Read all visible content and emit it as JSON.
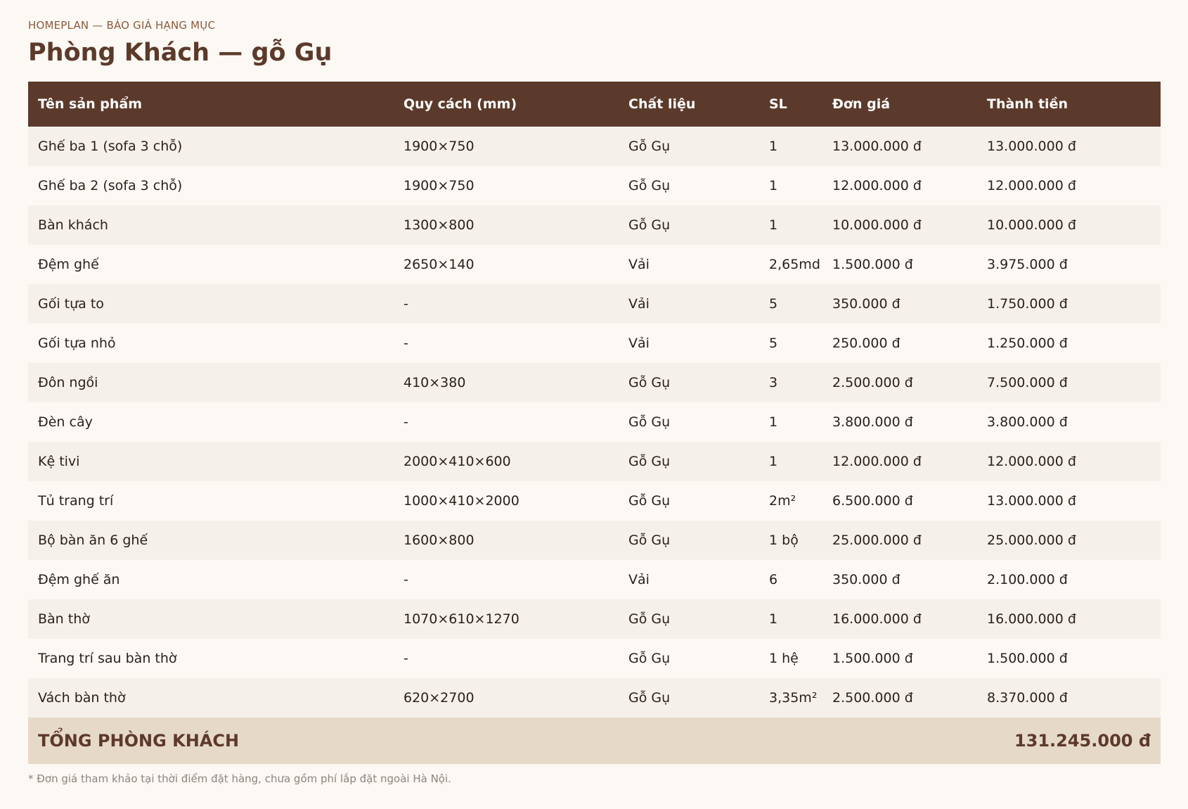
{
  "header": {
    "kicker": "HOMEPLAN — BÁO GIÁ HẠNG MỤC",
    "title": "Phòng Khách — gỗ Gụ"
  },
  "table": {
    "columns": [
      "Tên sản phẩm",
      "Quy cách (mm)",
      "Chất liệu",
      "SL",
      "Đơn giá",
      "Thành tiền"
    ],
    "rows": [
      [
        "Ghế ba 1 (sofa 3 chỗ)",
        "1900×750",
        "Gỗ Gụ",
        "1",
        "13.000.000 đ",
        "13.000.000 đ"
      ],
      [
        "Ghế ba 2 (sofa 3 chỗ)",
        "1900×750",
        "Gỗ Gụ",
        "1",
        "12.000.000 đ",
        "12.000.000 đ"
      ],
      [
        "Bàn khách",
        "1300×800",
        "Gỗ Gụ",
        "1",
        "10.000.000 đ",
        "10.000.000 đ"
      ],
      [
        "Đệm ghế",
        "2650×140",
        "Vải",
        "2,65md",
        "1.500.000 đ",
        "3.975.000 đ"
      ],
      [
        "Gối tựa to",
        "-",
        "Vải",
        "5",
        "350.000 đ",
        "1.750.000 đ"
      ],
      [
        "Gối tựa nhỏ",
        "-",
        "Vải",
        "5",
        "250.000 đ",
        "1.250.000 đ"
      ],
      [
        "Đôn ngồi",
        "410×380",
        "Gỗ Gụ",
        "3",
        "2.500.000 đ",
        "7.500.000 đ"
      ],
      [
        "Đèn cây",
        "-",
        "Gỗ Gụ",
        "1",
        "3.800.000 đ",
        "3.800.000 đ"
      ],
      [
        "Kệ tivi",
        "2000×410×600",
        "Gỗ Gụ",
        "1",
        "12.000.000 đ",
        "12.000.000 đ"
      ],
      [
        "Tủ trang trí",
        "1000×410×2000",
        "Gỗ Gụ",
        "2m²",
        "6.500.000 đ",
        "13.000.000 đ"
      ],
      [
        "Bộ bàn ăn 6 ghế",
        "1600×800",
        "Gỗ Gụ",
        "1 bộ",
        "25.000.000 đ",
        "25.000.000 đ"
      ],
      [
        "Đệm ghế ăn",
        "-",
        "Vải",
        "6",
        "350.000 đ",
        "2.100.000 đ"
      ],
      [
        "Bàn thờ",
        "1070×610×1270",
        "Gỗ Gụ",
        "1",
        "16.000.000 đ",
        "16.000.000 đ"
      ],
      [
        "Trang trí sau bàn thờ",
        "-",
        "Gỗ Gụ",
        "1 hệ",
        "1.500.000 đ",
        "1.500.000 đ"
      ],
      [
        "Vách bàn thờ",
        "620×2700",
        "Gỗ Gụ",
        "3,35m²",
        "2.500.000 đ",
        "8.370.000 đ"
      ]
    ],
    "total_label": "TỔNG PHÒNG KHÁCH",
    "total_value": "131.245.000 đ"
  },
  "footnote": "* Đơn giá tham khảo tại thời điểm đặt hàng, chưa gồm phí lắp đặt ngoài Hà Nội.",
  "colors": {
    "accent": "#5c3a2b",
    "background": "#fcf9f5",
    "row_alt": "#f5f0ea",
    "total_bg": "#e7d9c8",
    "kicker": "#8a5a3c"
  }
}
